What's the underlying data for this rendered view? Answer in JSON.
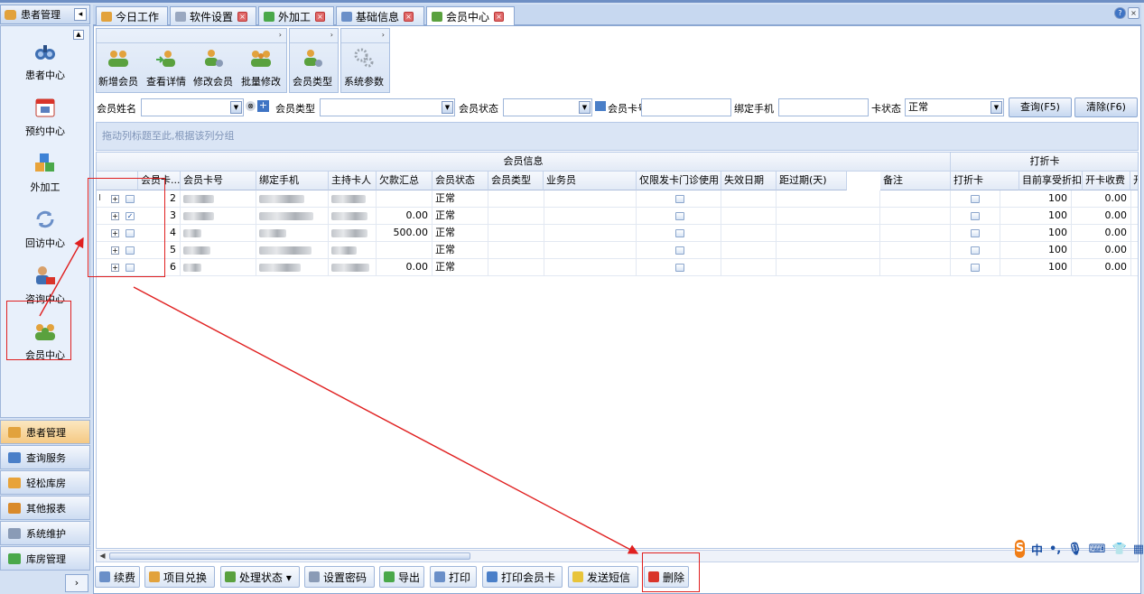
{
  "nav": {
    "header": "患者管理",
    "items": [
      {
        "label": "患者中心",
        "icon": "binoculars-icon"
      },
      {
        "label": "预约中心",
        "icon": "calendar-icon"
      },
      {
        "label": "外加工",
        "icon": "cubes-icon"
      },
      {
        "label": "回访中心",
        "icon": "refresh-icon"
      },
      {
        "label": "咨询中心",
        "icon": "consultant-icon"
      },
      {
        "label": "会员中心",
        "icon": "members-icon"
      }
    ],
    "groups": [
      {
        "label": "患者管理",
        "icon": "users-icon"
      },
      {
        "label": "查询服务",
        "icon": "query-icon"
      },
      {
        "label": "轻松库房",
        "icon": "warehouse-icon"
      },
      {
        "label": "其他报表",
        "icon": "report-icon"
      },
      {
        "label": "系统维护",
        "icon": "maintenance-icon"
      },
      {
        "label": "库房管理",
        "icon": "storage-icon"
      }
    ],
    "more": "›"
  },
  "tabs": [
    {
      "label": "今日工作",
      "closable": false
    },
    {
      "label": "软件设置",
      "closable": true
    },
    {
      "label": "外加工",
      "closable": true
    },
    {
      "label": "基础信息",
      "closable": true
    },
    {
      "label": "会员中心",
      "closable": true
    }
  ],
  "ribbon": {
    "group_caption": "›",
    "buttons": [
      {
        "label": "新增会员",
        "icon": "add-member-icon"
      },
      {
        "label": "查看详情",
        "icon": "view-detail-icon"
      },
      {
        "label": "修改会员",
        "icon": "edit-member-icon"
      },
      {
        "label": "批量修改",
        "icon": "batch-edit-icon"
      },
      {
        "label": "会员类型",
        "icon": "member-type-icon"
      },
      {
        "label": "系统参数",
        "icon": "gears-icon"
      }
    ]
  },
  "filter": {
    "name_label": "会员姓名",
    "type_label": "会员类型",
    "status_label": "会员状态",
    "card_label": "会员卡号",
    "phone_label": "绑定手机",
    "card_status_label": "卡状态",
    "card_status_value": "正常",
    "query_button": "查询(F5)",
    "clear_button": "清除(F6)"
  },
  "grid": {
    "group_hint": "拖动列标题至此,根据该列分组",
    "band1": "会员信息",
    "band2": "打折卡",
    "columns": [
      "会员卡...",
      "会员卡号",
      "绑定手机",
      "主持卡人",
      "欠款汇总",
      "会员状态",
      "会员类型",
      "业务员",
      "仅限发卡门诊使用",
      "失效日期",
      "距过期(天)",
      "备注",
      "打折卡",
      "目前享受折扣",
      "开卡收费",
      "开"
    ],
    "rows": [
      {
        "id": "2",
        "debt": "",
        "status": "正常",
        "discount": "100",
        "fee": "0.00",
        "checked": false
      },
      {
        "id": "3",
        "debt": "0.00",
        "status": "正常",
        "discount": "100",
        "fee": "0.00",
        "checked": true
      },
      {
        "id": "4",
        "debt": "500.00",
        "status": "正常",
        "discount": "100",
        "fee": "0.00",
        "checked": false
      },
      {
        "id": "5",
        "debt": "",
        "status": "正常",
        "discount": "100",
        "fee": "0.00",
        "checked": false
      },
      {
        "id": "6",
        "debt": "0.00",
        "status": "正常",
        "discount": "100",
        "fee": "0.00",
        "checked": false
      }
    ]
  },
  "bottom": {
    "buttons": [
      {
        "label": "续费",
        "icon": "renew-icon"
      },
      {
        "label": "项目兑换",
        "icon": "exchange-icon"
      },
      {
        "label": "处理状态 ▾",
        "icon": "process-icon"
      },
      {
        "label": "设置密码",
        "icon": "password-icon"
      },
      {
        "label": "导出",
        "icon": "export-icon"
      },
      {
        "label": "打印",
        "icon": "print-icon"
      },
      {
        "label": "打印会员卡",
        "icon": "print-card-icon"
      },
      {
        "label": "发送短信",
        "icon": "sms-icon"
      },
      {
        "label": "删除",
        "icon": "delete-icon"
      }
    ]
  },
  "ime": {
    "brand": "S",
    "mode": "中",
    "punct": "•,"
  },
  "colors": {
    "accent": "#3f74c4",
    "annotation": "#e02020"
  }
}
